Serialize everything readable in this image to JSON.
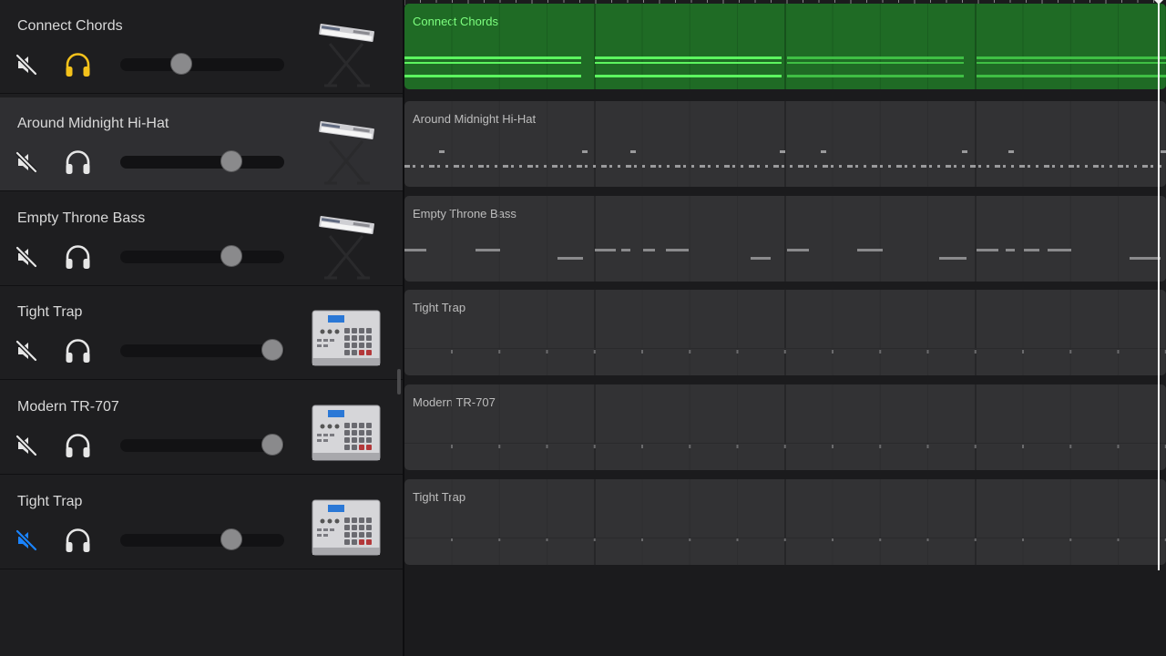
{
  "tracks": [
    {
      "name": "Connect Chords",
      "instrument": "keyboard-stand-icon",
      "muted": false,
      "solo": true,
      "volume": 0.37,
      "selected": false,
      "region_color": "green"
    },
    {
      "name": "Around Midnight Hi-Hat",
      "instrument": "keyboard-stand-icon",
      "muted": false,
      "solo": false,
      "volume": 0.68,
      "selected": true,
      "region_color": "gray"
    },
    {
      "name": "Empty Throne Bass",
      "instrument": "keyboard-stand-icon",
      "muted": false,
      "solo": false,
      "volume": 0.68,
      "selected": false,
      "region_color": "gray"
    },
    {
      "name": "Tight Trap",
      "instrument": "drum-machine-icon",
      "muted": false,
      "solo": false,
      "volume": 0.93,
      "selected": false,
      "region_color": "gray"
    },
    {
      "name": "Modern TR-707",
      "instrument": "drum-machine-icon",
      "muted": false,
      "solo": false,
      "volume": 0.93,
      "selected": false,
      "region_color": "gray"
    },
    {
      "name": "Tight Trap",
      "instrument": "drum-machine-icon",
      "muted": true,
      "solo": false,
      "volume": 0.68,
      "selected": false,
      "region_color": "gray"
    }
  ],
  "colors": {
    "solo_active": "#f4c21b",
    "mute_active": "#1a84ff",
    "region_green": "#1f6b25",
    "note_green": "#5cf55f",
    "region_gray": "#323234",
    "icon_default": "#e6e6e6"
  },
  "icons": {
    "mute": "speaker-muted-icon",
    "solo": "headphones-icon"
  }
}
